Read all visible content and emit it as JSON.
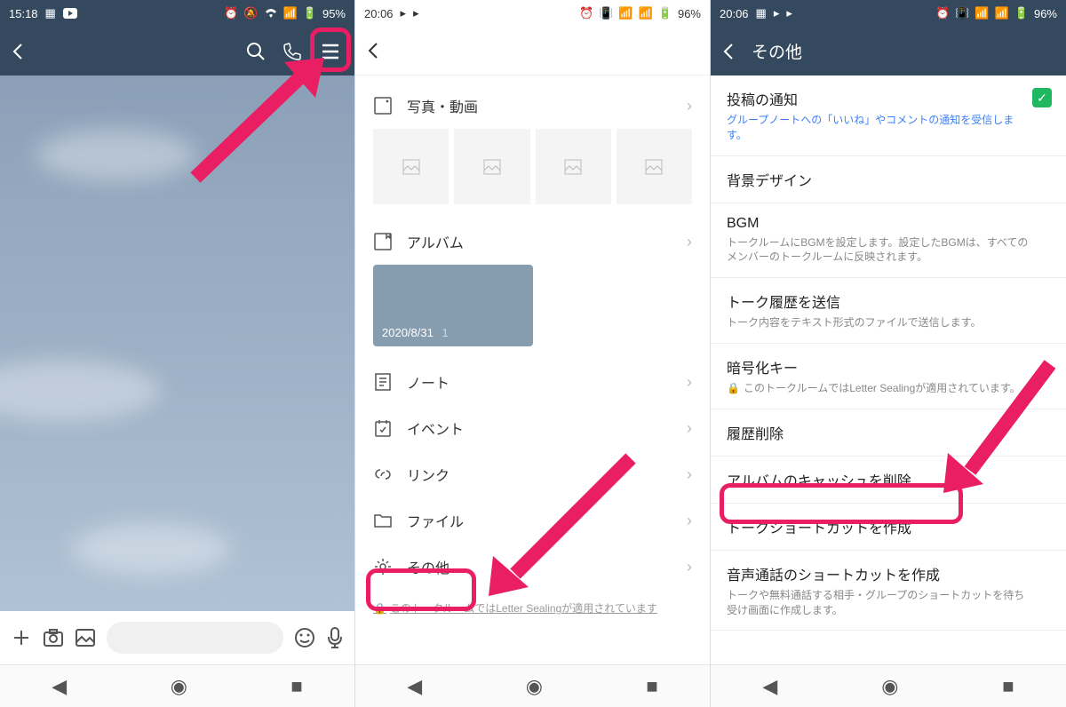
{
  "screen1": {
    "status": {
      "time": "15:18",
      "battery": "95%"
    },
    "header": {
      "title": ""
    },
    "input": {
      "placeholder": ""
    }
  },
  "screen2": {
    "status": {
      "time": "20:06",
      "battery": "96%"
    },
    "menu": {
      "photos": "写真・動画",
      "album": "アルバム",
      "album_date": "2020/8/31",
      "album_count": "1",
      "note": "ノート",
      "event": "イベント",
      "link": "リンク",
      "file": "ファイル",
      "other": "その他"
    },
    "footer": "このトークルームではLetter Sealingが適用されています"
  },
  "screen3": {
    "status": {
      "time": "20:06",
      "battery": "96%"
    },
    "header": {
      "title": "その他"
    },
    "rows": {
      "notify_title": "投稿の通知",
      "notify_sub": "グループノートへの「いいね」やコメントの通知を受信します。",
      "bg_title": "背景デザイン",
      "bgm_title": "BGM",
      "bgm_sub": "トークルームにBGMを設定します。設定したBGMは、すべてのメンバーのトークルームに反映されます。",
      "hist_send_title": "トーク履歴を送信",
      "hist_send_sub": "トーク内容をテキスト形式のファイルで送信します。",
      "enc_title": "暗号化キー",
      "enc_sub": "このトークルームではLetter Sealingが適用されています。",
      "hist_del_title": "履歴削除",
      "album_cache_title": "アルバムのキャッシュを削除",
      "shortcut_title": "トークショートカットを作成",
      "voice_title": "音声通話のショートカットを作成",
      "voice_sub": "トークや無料通話する相手・グループのショートカットを待ち受け画面に作成します。"
    }
  }
}
